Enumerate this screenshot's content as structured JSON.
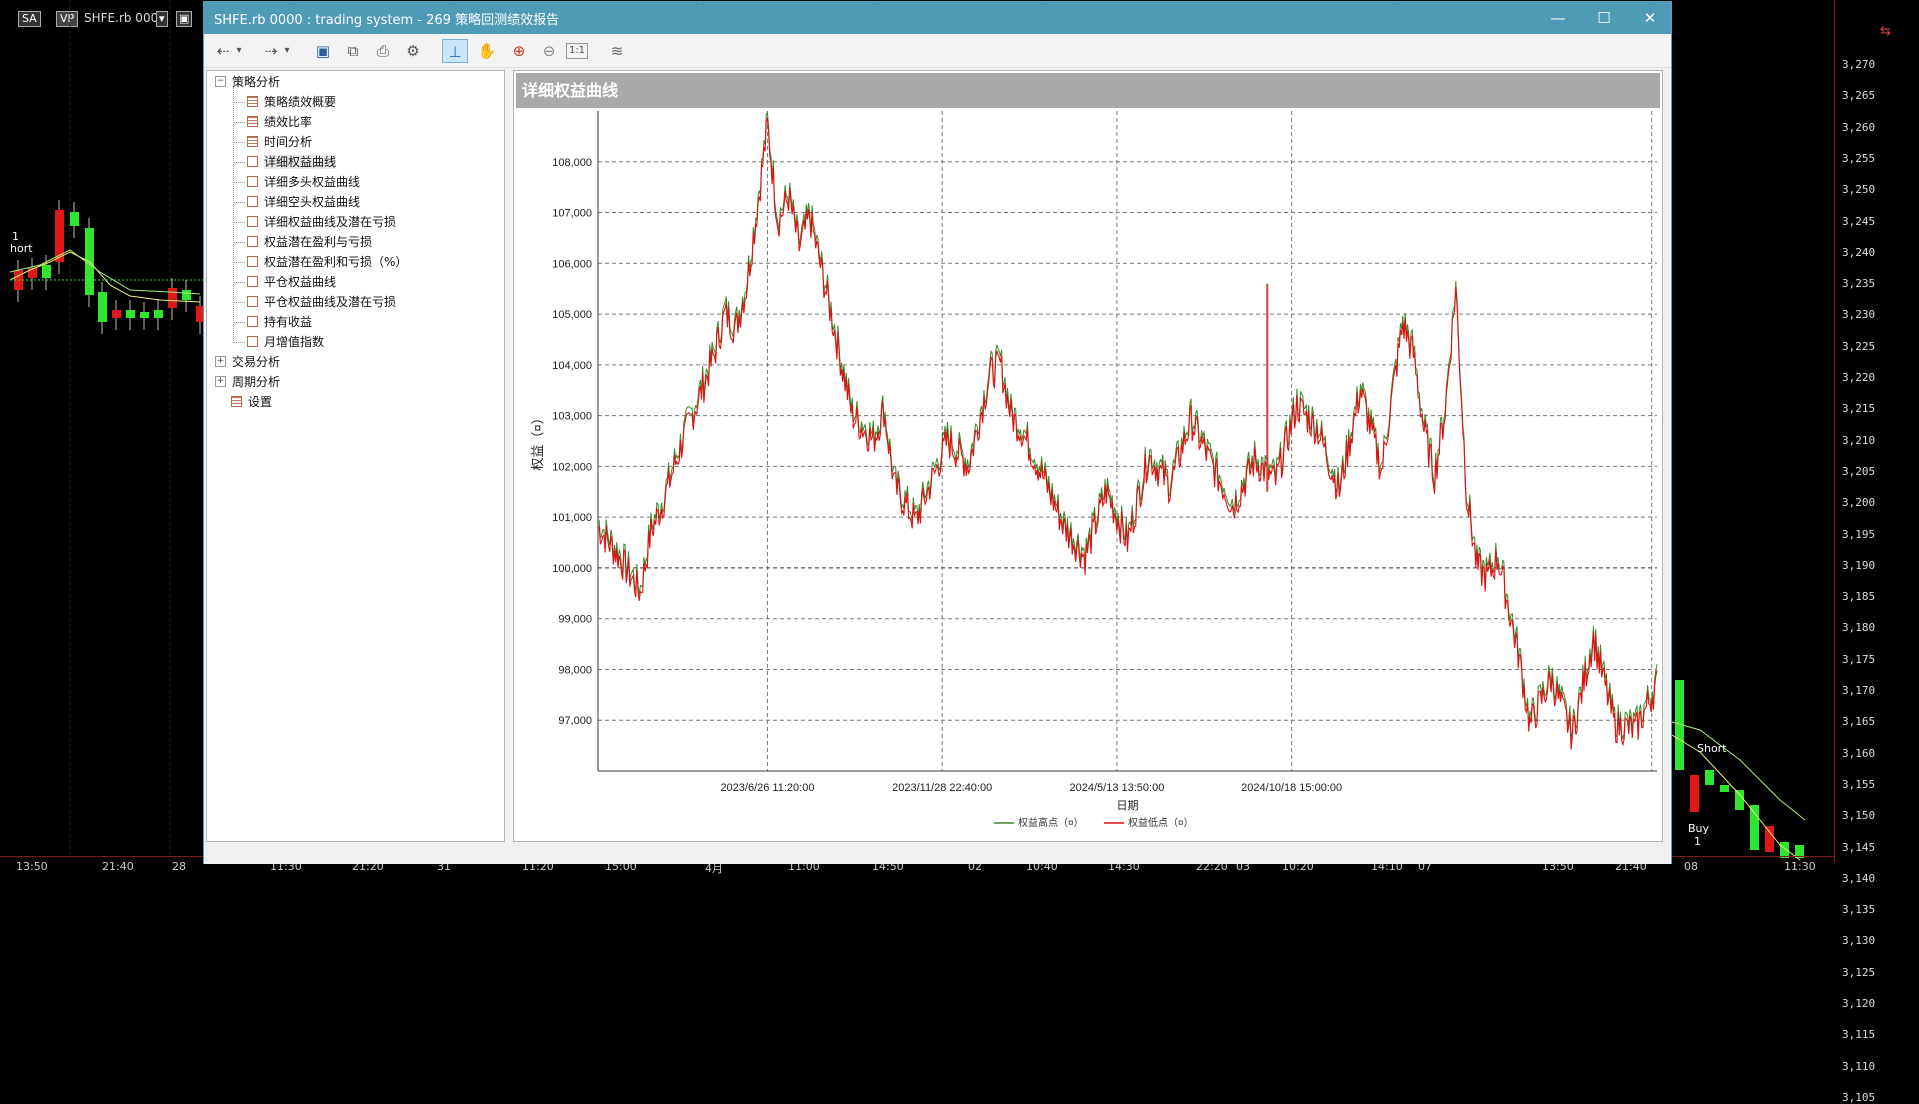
{
  "background_app": {
    "symbol_badge": "SA",
    "vp_badge": "VP",
    "contract": "SHFE.rb 0000",
    "price_ticks": [
      "3,270",
      "3,265",
      "3,260",
      "3,255",
      "3,250",
      "3,245",
      "3,240",
      "3,235",
      "3,230",
      "3,225",
      "3,220",
      "3,215",
      "3,210",
      "3,205",
      "3,200",
      "3,195",
      "3,190",
      "3,185",
      "3,180",
      "3,175",
      "3,170",
      "3,165",
      "3,160",
      "3,155",
      "3,150",
      "3,145",
      "3,140",
      "3,135",
      "3,130",
      "3,125",
      "3,120",
      "3,115",
      "3,110",
      "3,105"
    ],
    "time_ticks": [
      "13:50",
      "21:40",
      "28",
      "11:30",
      "21:20",
      "31",
      "11:20",
      "15:00",
      "4月",
      "11:00",
      "14:50",
      "02",
      "10:40",
      "14:30",
      "22:20",
      "03",
      "10:20",
      "14:10",
      "07",
      "13:50",
      "21:40",
      "08",
      "11:30"
    ],
    "left_labels": {
      "signal_num": "1",
      "signal_text": "hort"
    },
    "right_labels": {
      "short": "Short",
      "buy": "Buy",
      "buy_num": "1"
    }
  },
  "window": {
    "title": "SHFE.rb 0000 : trading system - 269 策略回测绩效报告",
    "minimize": "—",
    "maximize": "☐",
    "close": "✕"
  },
  "toolbar": {
    "icons": [
      "back-icon",
      "dropdown-icon",
      "forward-icon",
      "dropdown-icon",
      "save-icon",
      "export-icon",
      "print-icon",
      "settings-icon",
      "crosshair-icon",
      "hand-icon",
      "zoom-in-icon",
      "zoom-out-icon",
      "actual-size-icon",
      "chart-style-icon"
    ],
    "actual_size_label": "1:1"
  },
  "tree": {
    "root": "策略分析",
    "children": [
      "策略绩效概要",
      "绩效比率",
      "时间分析",
      "详细权益曲线",
      "详细多头权益曲线",
      "详细空头权益曲线",
      "详细权益曲线及潜在亏损",
      "权益潜在盈利与亏损",
      "权益潜在盈利和亏损（%）",
      "平仓权益曲线",
      "平仓权益曲线及潜在亏损",
      "持有收益",
      "月增值指数"
    ],
    "other_roots": [
      "交易分析",
      "周期分析",
      "设置"
    ],
    "active": "详细权益曲线"
  },
  "chart_panel": {
    "header": "详细权益曲线"
  },
  "chart_data": {
    "type": "line",
    "title": "",
    "xlabel": "日期",
    "ylabel": "权益（¤）",
    "x_tick_labels": [
      "2023/6/26 11:20:00",
      "2023/11/28 22:40:00",
      "2024/5/13 13:50:00",
      "2024/10/18 15:00:00"
    ],
    "y_tick_labels": [
      "97,000",
      "98,000",
      "99,000",
      "100,000",
      "101,000",
      "102,000",
      "103,000",
      "104,000",
      "105,000",
      "106,000",
      "107,000",
      "108,000"
    ],
    "ylim": [
      96000,
      109000
    ],
    "grid": true,
    "legend_position": "bottom",
    "series": [
      {
        "name": "权益高点（¤）",
        "color": "#3a8a2a"
      },
      {
        "name": "权益低点（¤）",
        "color": "#e01010"
      }
    ],
    "x_norm": [
      0,
      0.02,
      0.04,
      0.05,
      0.06,
      0.08,
      0.1,
      0.11,
      0.12,
      0.13,
      0.14,
      0.15,
      0.16,
      0.17,
      0.18,
      0.19,
      0.2,
      0.22,
      0.24,
      0.26,
      0.27,
      0.28,
      0.3,
      0.33,
      0.35,
      0.37,
      0.38,
      0.39,
      0.4,
      0.42,
      0.44,
      0.46,
      0.48,
      0.5,
      0.52,
      0.54,
      0.56,
      0.58,
      0.6,
      0.62,
      0.64,
      0.66,
      0.68,
      0.7,
      0.72,
      0.74,
      0.75,
      0.76,
      0.77,
      0.78,
      0.79,
      0.8,
      0.81,
      0.82,
      0.83,
      0.84,
      0.85,
      0.86,
      0.87,
      0.88,
      0.9,
      0.92,
      0.94,
      0.96,
      0.98,
      1.0
    ],
    "values": [
      100800,
      100200,
      99500,
      100700,
      101200,
      102500,
      103600,
      104200,
      105000,
      104700,
      105500,
      107000,
      108700,
      106800,
      107300,
      106300,
      106900,
      105000,
      103000,
      102500,
      103100,
      101600,
      100900,
      102500,
      102000,
      103800,
      104000,
      103000,
      102700,
      101800,
      100800,
      100200,
      101500,
      100500,
      102200,
      101600,
      102900,
      102000,
      101200,
      102100,
      101700,
      103200,
      102700,
      101500,
      103500,
      101900,
      103400,
      104800,
      104200,
      102700,
      101800,
      103100,
      105500,
      101500,
      100000,
      99800,
      100200,
      99200,
      98200,
      96900,
      97800,
      96700,
      98600,
      96900,
      96800,
      97700,
      97600
    ]
  }
}
